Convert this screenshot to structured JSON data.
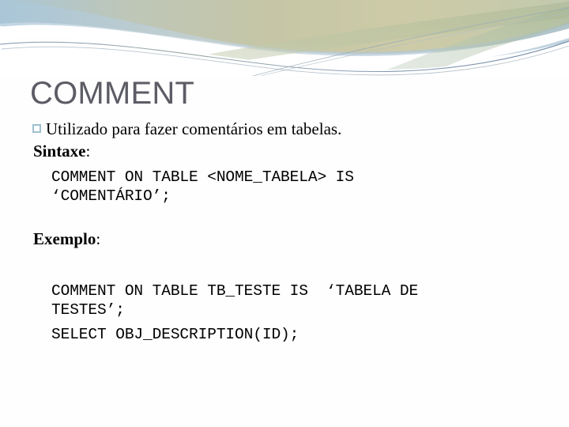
{
  "slide": {
    "title": "COMMENT",
    "title_color": "#5c5c66",
    "background_color": "#fefefe",
    "bullet": {
      "marker": "hollow-square-bullet",
      "marker_color": "#9fc0cf",
      "text": "Utilizado para fazer comentários em tabelas."
    },
    "syntax": {
      "label": "Sintaxe",
      "label_suffix": ":",
      "code_line_1": "COMMENT ON TABLE <NOME_TABELA> IS",
      "code_line_2": "‘COMENTÁRIO’;"
    },
    "example": {
      "label": "Exemplo",
      "label_suffix": ":",
      "code_line_1": "COMMENT ON TABLE TB_TESTE IS  ‘TABELA DE",
      "code_line_2": "TESTES’;",
      "code_line_3": "SELECT OBJ_DESCRIPTION(ID);"
    }
  },
  "decor": {
    "name": "swoosh-banner",
    "colors": {
      "khaki": "#c3c4a8",
      "olive": "#b6bc9a",
      "steel_blue": "#a8c3d4",
      "pale_blue": "#c9dbe6",
      "sage": "#c8d2bc",
      "line_blue": "#6f8fae",
      "white": "#ffffff"
    }
  }
}
